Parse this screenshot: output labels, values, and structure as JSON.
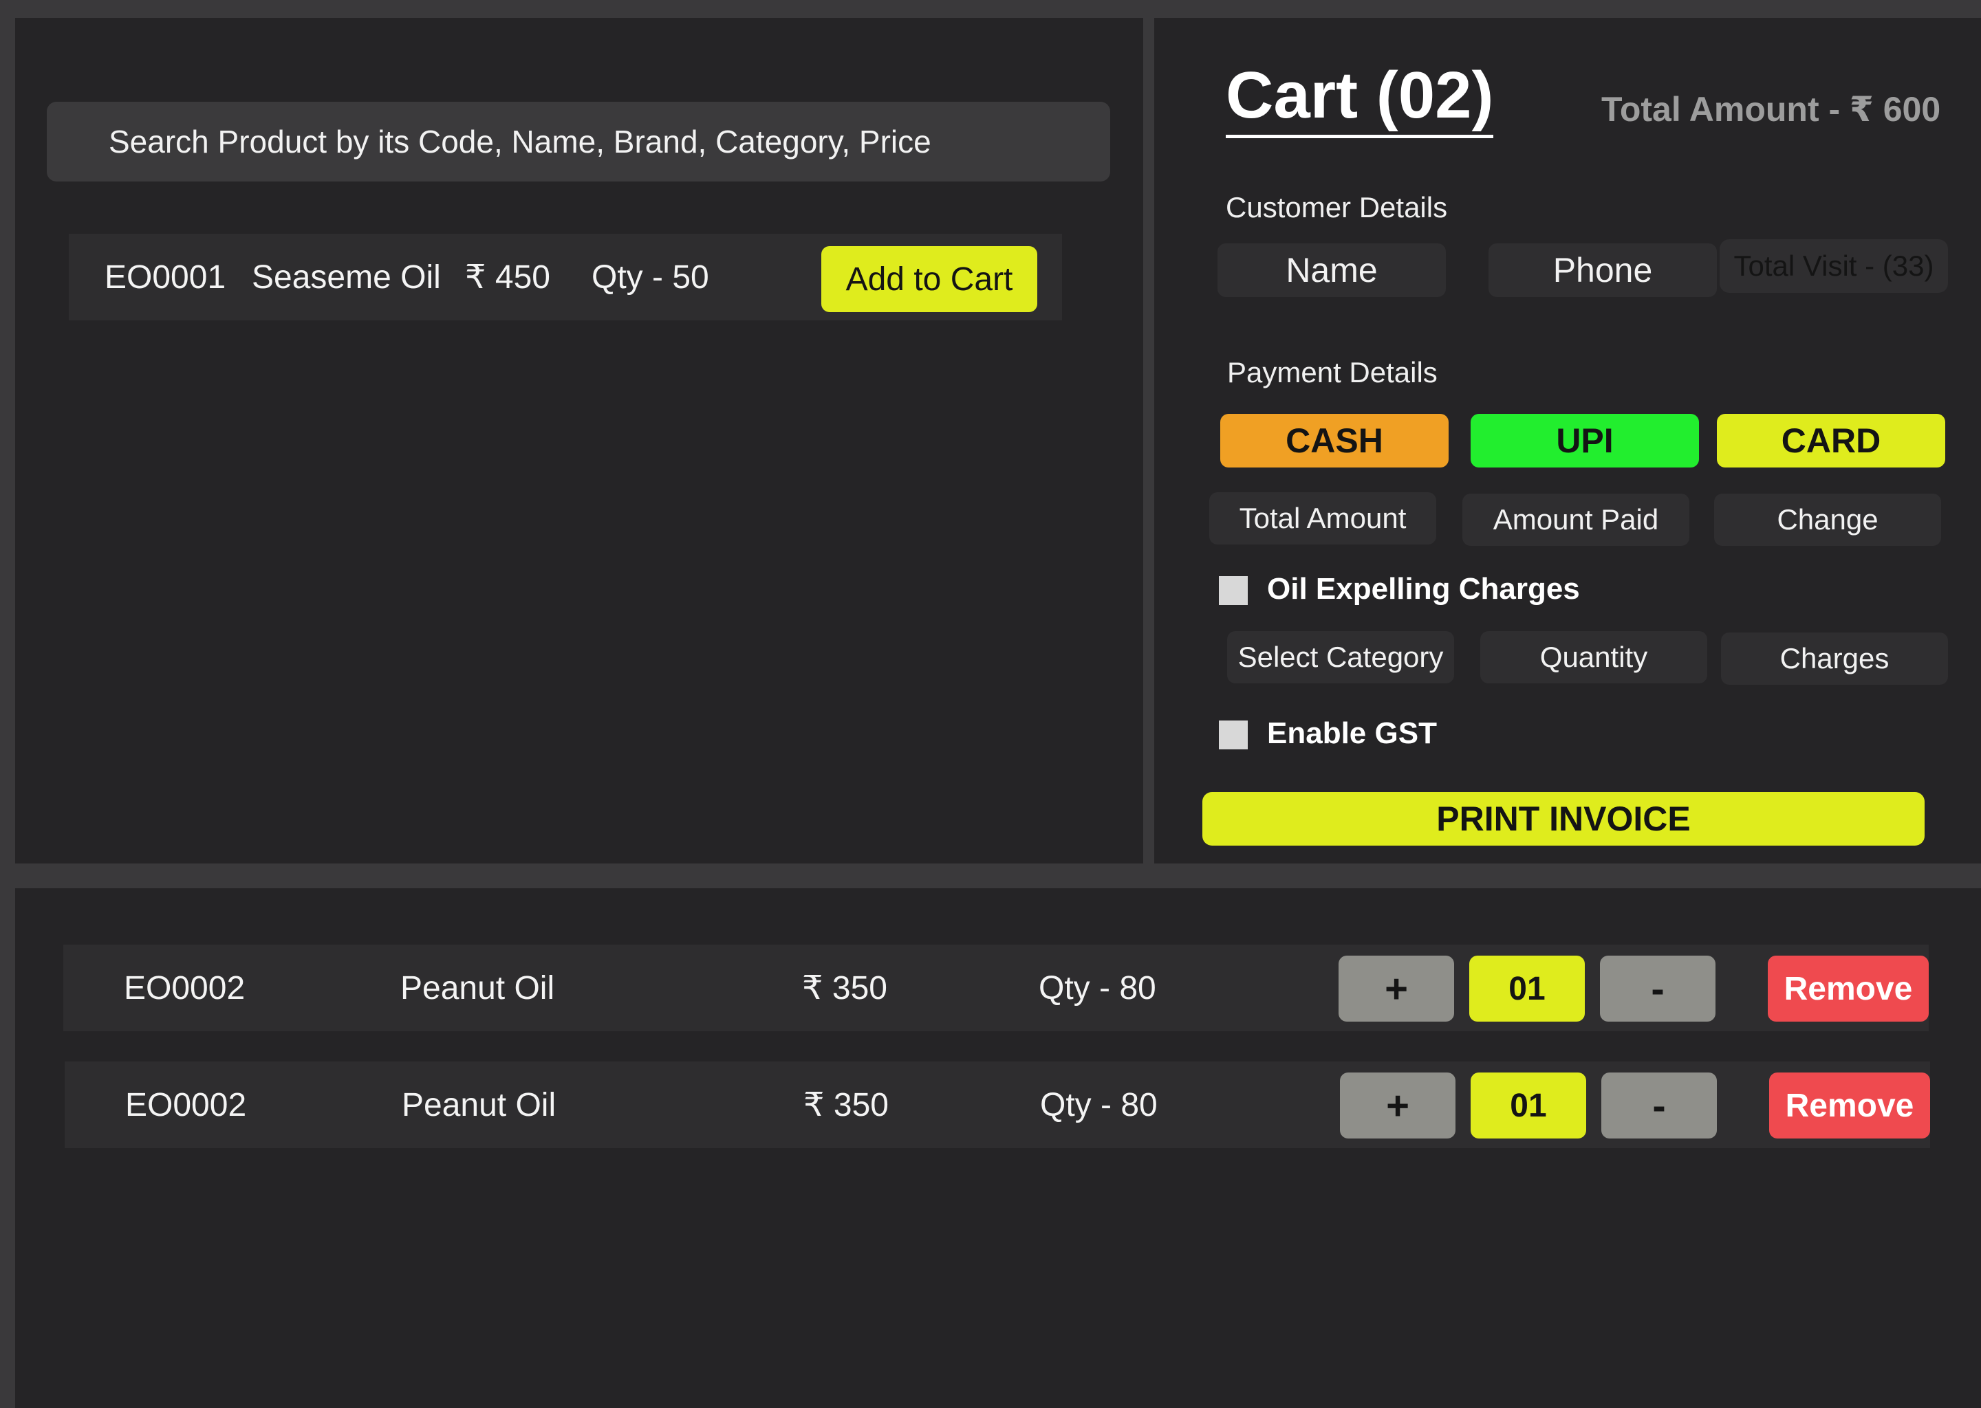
{
  "search": {
    "placeholder": "Search Product by its Code, Name, Brand, Category, Price",
    "result": {
      "code": "EO0001",
      "name": "Seaseme Oil",
      "price": "₹ 450",
      "qty": "Qty - 50",
      "add_label": "Add to Cart"
    }
  },
  "cart": {
    "title": "Cart (02)",
    "total_amount": "Total Amount - ₹ 600",
    "customer": {
      "section_label": "Customer Details",
      "name_placeholder": "Name",
      "phone_placeholder": "Phone",
      "total_visit": "Total Visit - (33)"
    },
    "payment": {
      "section_label": "Payment Details",
      "methods": [
        "CASH",
        "UPI",
        "CARD"
      ],
      "total_amount_placeholder": "Total Amount",
      "amount_paid_placeholder": "Amount Paid",
      "change_placeholder": "Change"
    },
    "oil_expelling": {
      "label": "Oil Expelling Charges",
      "select_category": "Select Category",
      "quantity": "Quantity",
      "charges": "Charges"
    },
    "gst": {
      "label": "Enable GST"
    },
    "print_label": "PRINT INVOICE"
  },
  "cart_items": [
    {
      "code": "EO0002",
      "name": "Peanut Oil",
      "price": "₹ 350",
      "stock": "Qty - 80",
      "plus": "+",
      "count": "01",
      "minus": "-",
      "remove": "Remove"
    },
    {
      "code": "EO0002",
      "name": "Peanut Oil",
      "price": "₹ 350",
      "stock": "Qty - 80",
      "plus": "+",
      "count": "01",
      "minus": "-",
      "remove": "Remove"
    }
  ],
  "colors": {
    "accent_yellow": "#dfec1d",
    "cash_orange": "#f0a024",
    "upi_green": "#22ee2e",
    "remove_red": "#ef4a4f",
    "panel_bg": "#252426"
  }
}
